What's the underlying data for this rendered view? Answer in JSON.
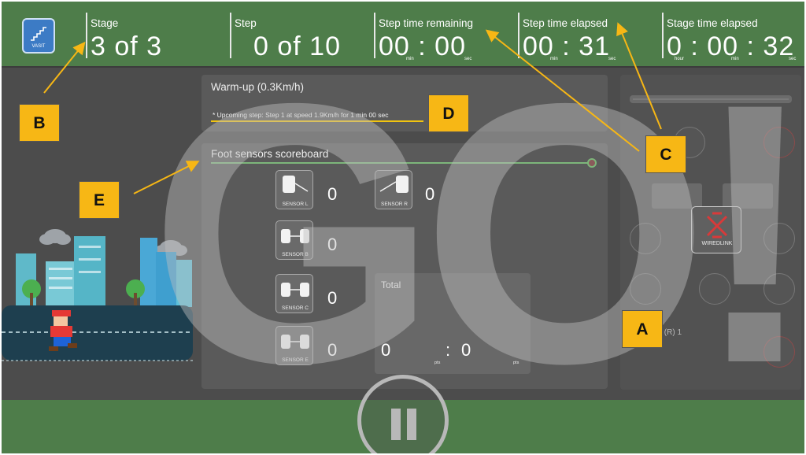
{
  "header": {
    "logo_text": "VASIT",
    "stage": {
      "label": "Stage",
      "value": "3 of 3"
    },
    "step": {
      "label": "Step",
      "value": "0 of 10"
    },
    "step_remaining": {
      "label": "Step time remaining",
      "value": "00 : 00",
      "units": [
        "min",
        "sec"
      ]
    },
    "step_elapsed": {
      "label": "Step time elapsed",
      "value": "00 : 31",
      "units": [
        "min",
        "sec"
      ]
    },
    "stage_elapsed": {
      "label": "Stage time elapsed",
      "value": "0 : 00 : 32",
      "units": [
        "hour",
        "min",
        "sec"
      ]
    }
  },
  "warmup": {
    "title": "Warm-up (0.3Km/h)",
    "upcoming": "* Upcoming step: Step 1 at speed 1.9Km/h for 1 min 00 sec"
  },
  "scoreboard": {
    "title": "Foot sensors scoreboard",
    "sensors": [
      {
        "label": "SENSOR L",
        "value": "0"
      },
      {
        "label": "SENSOR R",
        "value": "0"
      },
      {
        "label": "SENSOR B",
        "value": "0"
      },
      {
        "label": "SENSOR C",
        "value": "0"
      },
      {
        "label": "SENSOR E",
        "value": "0"
      }
    ],
    "total": {
      "label": "Total",
      "left": "0",
      "colon": ":",
      "right": "0",
      "unit": "pts"
    }
  },
  "right_panel": {
    "wiredlink": "WIREDLINK",
    "kg_text": "(Kg): (L)  1    (R)  1",
    "accent": "#d83a3a"
  },
  "overlay": {
    "text": "GO!"
  },
  "callouts": [
    "A",
    "B",
    "C",
    "D",
    "E"
  ],
  "colors": {
    "header_green": "#4e7d4a",
    "background": "#4c4c4c",
    "callout": "#f7b715"
  }
}
